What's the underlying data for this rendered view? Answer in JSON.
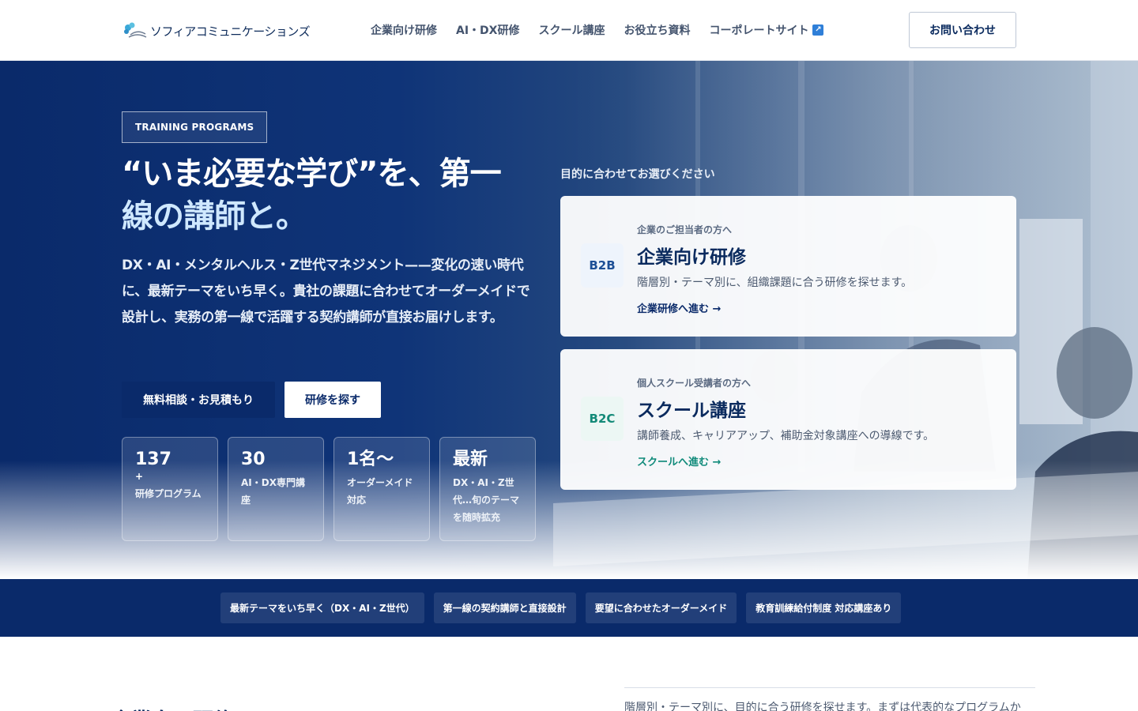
{
  "header": {
    "logo_text": "ソフィアコミュニケーションズ",
    "nav": [
      {
        "label": "企業向け研修"
      },
      {
        "label": "AI・DX研修"
      },
      {
        "label": "スクール講座"
      },
      {
        "label": "お役立ち資料"
      },
      {
        "label": "コーポレートサイト"
      }
    ],
    "contact_label": "お問い合わせ"
  },
  "hero": {
    "tag": "TRAINING PROGRAMS",
    "headline_part1": "“いま必要な学び”を、第一",
    "headline_part2": "線の講師と。",
    "lead": "DX・AI・メンタルヘルス・Z世代マネジメント——変化の速い時代に、最新テーマをいち早く。貴社の課題に合わせてオーダーメイドで設計し、実務の第一線で活躍する契約講師が直接お届けします。",
    "primary_button": "無料相談・お見積もり",
    "secondary_button": "研修を探す",
    "stats": [
      {
        "value": "137",
        "plus": "+",
        "label": "研修プログラム"
      },
      {
        "value": "30",
        "plus": "",
        "label": "AI・DX専門講座"
      },
      {
        "value": "1名〜",
        "plus": "",
        "label": "オーダーメイド対応"
      },
      {
        "value": "最新",
        "plus": "",
        "label": "DX・AI・Z世代…旬のテーマを随時拡充"
      }
    ],
    "choose_label": "目的に合わせてお選びください",
    "cards": {
      "b2b": {
        "badge": "B2B",
        "sub": "企業のご担当者の方へ",
        "title": "企業向け研修",
        "desc": "階層別・テーマ別に、組織課題に合う研修を探せます。",
        "link": "企業研修へ進む →"
      },
      "b2c": {
        "badge": "B2C",
        "sub": "個人スクール受講者の方へ",
        "title": "スクール講座",
        "desc": "講師養成、キャリアアップ、補助金対象講座への導線です。",
        "link": "スクールへ進む →"
      }
    }
  },
  "strip": {
    "items": [
      "最新テーマをいち早く（DX・AI・Z世代）",
      "第一線の契約講師と直接設計",
      "要望に合わせたオーダーメイド",
      "教育訓練給付制度 対応講座あり"
    ]
  },
  "below": {
    "text": "階層別・テーマ別に、目的に合う研修を探せます。まずは代表的なプログラムか",
    "heading": "企業向け研修"
  },
  "colors": {
    "brand_navy": "#0a2a6a",
    "b2c_teal": "#0f8a7a",
    "external_icon": "#2f7fd8"
  }
}
